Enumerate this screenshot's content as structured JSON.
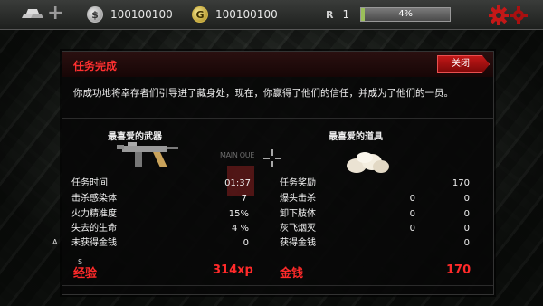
{
  "hud": {
    "silver_amount": "100100100",
    "gold_amount": "100100100",
    "silver_symbol": "$",
    "gold_symbol": "G",
    "rank_label": "R",
    "rank_value": "1",
    "xp_percent_text": "4%",
    "xp_fraction": 0.04
  },
  "dialog": {
    "title": "任务完成",
    "close_label": "关闭",
    "description": "你成功地将幸存者们引导进了藏身处，现在，你赢得了他们的信任，并成为了他们的一员。",
    "favorite_weapon_label": "最喜爱的武器",
    "favorite_item_label": "最喜爱的道具",
    "ghost_label": "MAIN QUE",
    "left_stats": [
      {
        "label": "任务时间",
        "value": "01:37"
      },
      {
        "label": "击杀感染体",
        "value": "7"
      },
      {
        "label": "火力精准度",
        "value": "15%"
      },
      {
        "label": "失去的生命",
        "value": "4 %"
      },
      {
        "label": "未获得金钱",
        "value": "0"
      }
    ],
    "right_stats": [
      {
        "label": "任务奖励",
        "mid": "",
        "value": "170"
      },
      {
        "label": "爆头击杀",
        "mid": "0",
        "value": "0"
      },
      {
        "label": "卸下肢体",
        "mid": "0",
        "value": "0"
      },
      {
        "label": "灰飞烟灭",
        "mid": "0",
        "value": "0"
      },
      {
        "label": "获得金钱",
        "mid": "",
        "value": "0"
      }
    ],
    "xp_total_label": "经验",
    "xp_total_value": "314xp",
    "money_total_label": "金钱",
    "money_total_value": "170",
    "side_marker_a": "A",
    "side_marker_s": "S"
  },
  "colors": {
    "accent_red": "#ff2a2a",
    "close_button": "#c41818",
    "xp_fill": "#9bbf5a"
  },
  "icons": {
    "bars": "silver-bars-icon",
    "plus": "plus-icon",
    "settings": "gear-icon",
    "weapon": "submachine-gun-icon",
    "item": "bread-rolls-icon"
  }
}
